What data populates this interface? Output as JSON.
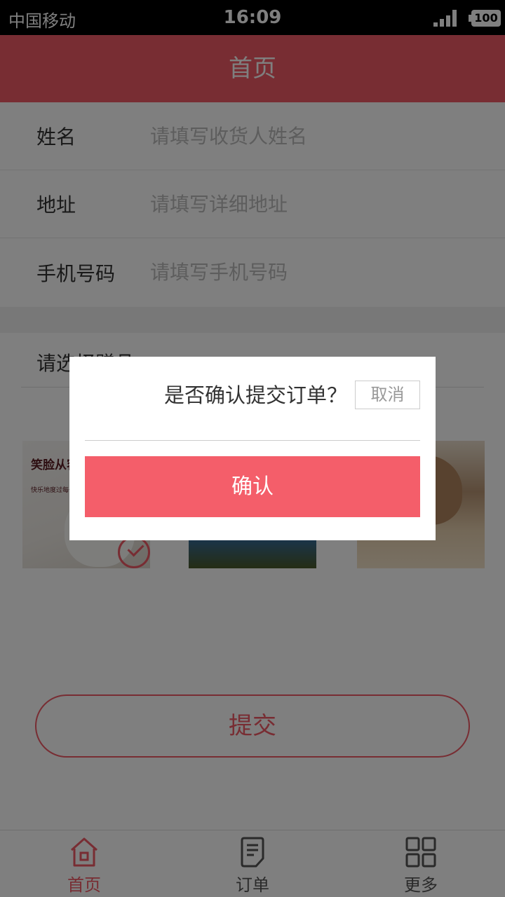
{
  "status_bar": {
    "carrier": "中国移动",
    "time": "16:09",
    "battery": "100"
  },
  "header": {
    "title": "首页"
  },
  "form": {
    "fields": [
      {
        "label": "姓名",
        "placeholder": "请填写收货人姓名",
        "value": ""
      },
      {
        "label": "地址",
        "placeholder": "请填写详细地址",
        "value": ""
      },
      {
        "label": "手机号码",
        "placeholder": "请填写手机号码",
        "value": ""
      }
    ]
  },
  "gift": {
    "title": "请选择赠品",
    "items": [
      {
        "name": "white-bear",
        "caption": "笑脸从容",
        "sub_caption": "快乐地度过每一天",
        "selected": true
      },
      {
        "name": "blue-knit-doll",
        "selected": false
      },
      {
        "name": "plush-elephant",
        "selected": false
      }
    ]
  },
  "submit": {
    "label": "提交"
  },
  "tabbar": {
    "items": [
      {
        "label": "首页",
        "icon": "home-icon",
        "active": true
      },
      {
        "label": "订单",
        "icon": "order-icon",
        "active": false
      },
      {
        "label": "更多",
        "icon": "grid-icon",
        "active": false
      }
    ]
  },
  "colors": {
    "accent": "#f05a66",
    "confirm": "#f45e6a"
  },
  "dialog": {
    "question": "是否确认提交订单？",
    "cancel_label": "取消",
    "confirm_label": "确认"
  }
}
